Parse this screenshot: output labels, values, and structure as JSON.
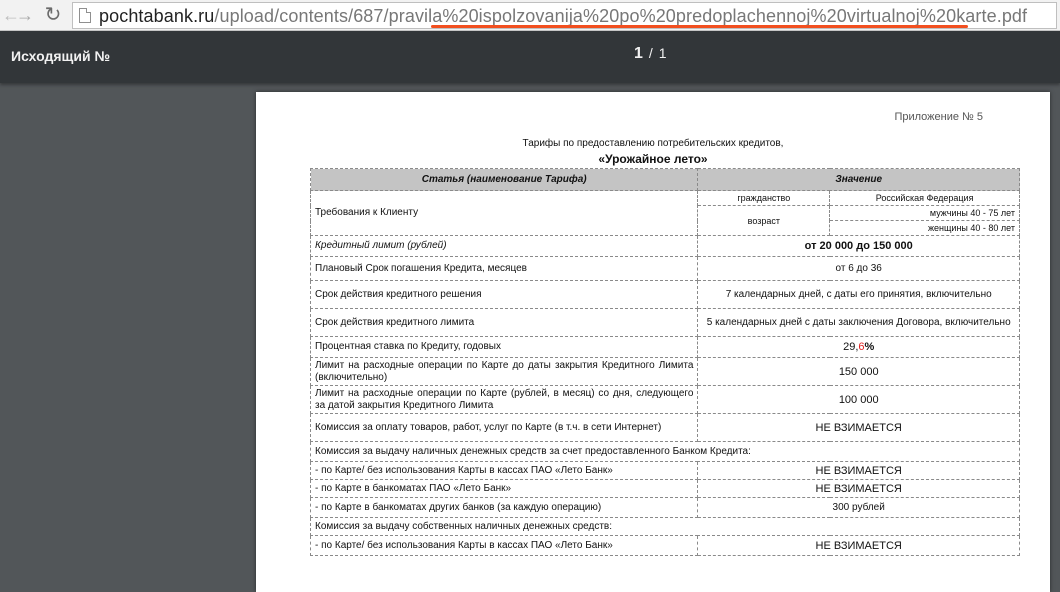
{
  "browser": {
    "url_host": "pochtabank.ru",
    "url_path": "/upload/contents/687/pravila%20ispolzovanija%20po%20predoplachennoj%20virtualnoj%20karte.pdf",
    "highlight_color": "#f24f1f"
  },
  "viewer": {
    "doc_title": "Исходящий №",
    "current_page": "1",
    "page_separator": "/",
    "total_pages": "1"
  },
  "document": {
    "appendix": "Приложение № 5",
    "heading_line1": "Тарифы по предоставлению потребительских кредитов,",
    "heading_line2": "«Урожайное лето»",
    "columns": [
      "Статья (наименование Тарифа)",
      "Значение"
    ],
    "client_requirements": {
      "label": "Требования к Клиенту",
      "citizenship_label": "гражданство",
      "citizenship_value": "Российская Федерация",
      "age_label": "возраст",
      "age_men": "мужчины 40 - 75 лет",
      "age_women": "женщины 40 - 80 лет"
    },
    "credit_limit": {
      "label": "Кредитный лимит (рублей)",
      "value": "от 20 000 до 150 000"
    },
    "term": {
      "label": "Плановый Срок погашения Кредита, месяцев",
      "value": "от 6 до 36"
    },
    "decision_validity": {
      "label": "Срок действия кредитного решения",
      "value": "7 календарных дней, с даты его принятия, включительно"
    },
    "limit_validity": {
      "label": "Срок действия кредитного лимита",
      "value": "5 календарных дней с даты заключения Договора, включительно"
    },
    "rate": {
      "label": "Процентная ставка по Кредиту, годовых",
      "value_a": "29,",
      "value_b": "6",
      "value_c": "%"
    },
    "limit_before": {
      "label": "Лимит на расходные операции по Карте до даты закрытия Кредитного Лимита (включительно)",
      "value": "150 000"
    },
    "limit_after": {
      "label": "Лимит на расходные операции по Карте (рублей, в месяц) со дня, следующего за датой закрытия Кредитного Лимита",
      "value": "100 000"
    },
    "purchase_fee": {
      "label": "Комиссия за оплату товаров, работ, услуг по Карте (в т.ч. в сети Интернет)",
      "value": "НЕ ВЗИМАЕТСЯ"
    },
    "cash_credit_header": "Комиссия за выдачу наличных денежных средств за счет предоставленного Банком Кредита:",
    "cash_credit_rows": [
      {
        "label": "- по Карте/ без использования Карты в кассах ПАО «Лето Банк»",
        "value": "НЕ ВЗИМАЕТСЯ"
      },
      {
        "label": "- по Карте в банкоматах ПАО «Лето Банк»",
        "value": "НЕ ВЗИМАЕТСЯ"
      },
      {
        "label": "- по Карте в банкоматах других банков (за каждую операцию)",
        "value": "300 рублей"
      }
    ],
    "cash_own_header": "Комиссия за выдачу собственных наличных денежных средств:",
    "cash_own_rows": [
      {
        "label": "- по Карте/ без использования Карты в кассах ПАО «Лето Банк»",
        "value": "НЕ ВЗИМАЕТСЯ"
      }
    ]
  }
}
